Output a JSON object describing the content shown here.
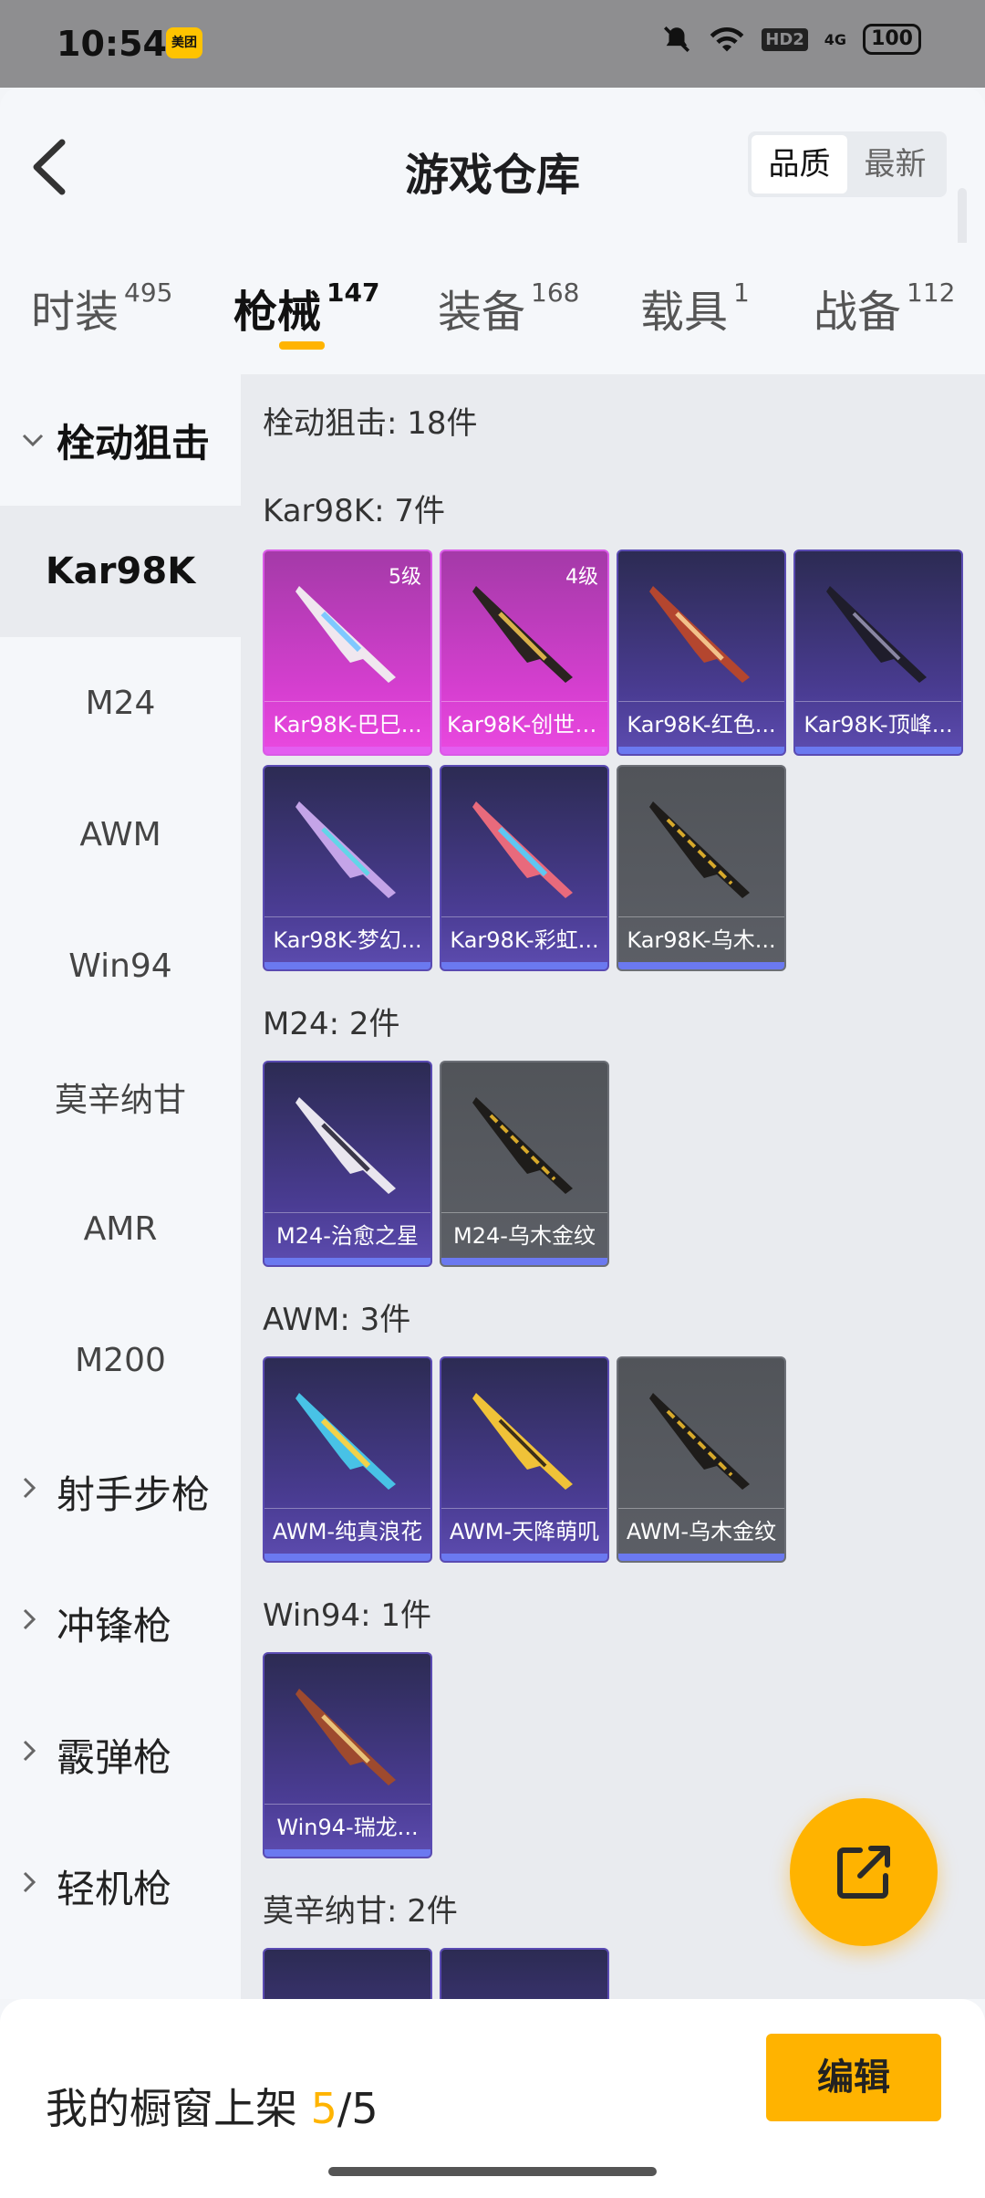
{
  "status_bar": {
    "time": "10:54",
    "app_badge": "美团",
    "hd_label": "HD2",
    "net_label": "4G",
    "battery": "100"
  },
  "header": {
    "title": "游戏仓库",
    "sort_options": [
      "品质",
      "最新"
    ]
  },
  "tabs": [
    {
      "label": "时装",
      "count": "495"
    },
    {
      "label": "枪械",
      "count": "147"
    },
    {
      "label": "装备",
      "count": "168"
    },
    {
      "label": "载具",
      "count": "1"
    },
    {
      "label": "战备",
      "count": "112"
    }
  ],
  "sidebar": {
    "group_open": "栓动狙击",
    "items": [
      "Kar98K",
      "M24",
      "AWM",
      "Win94",
      "莫辛纳甘",
      "AMR",
      "M200"
    ],
    "groups_closed": [
      "射手步枪",
      "冲锋枪",
      "霰弹枪",
      "轻机枪"
    ]
  },
  "content": {
    "category_total": "栓动狙击: 18件",
    "sections": [
      {
        "header": "Kar98K: 7件",
        "items": [
          {
            "name": "Kar98K-巴巳...",
            "level": "5级",
            "rarity": "pink"
          },
          {
            "name": "Kar98K-创世·...",
            "level": "4级",
            "rarity": "pink"
          },
          {
            "name": "Kar98K-红色...",
            "rarity": "purple"
          },
          {
            "name": "Kar98K-顶峰...",
            "rarity": "purple"
          },
          {
            "name": "Kar98K-梦幻...",
            "rarity": "purple"
          },
          {
            "name": "Kar98K-彩虹...",
            "rarity": "purple"
          },
          {
            "name": "Kar98K-乌木...",
            "rarity": "grey"
          }
        ]
      },
      {
        "header": "M24: 2件",
        "items": [
          {
            "name": "M24-治愈之星",
            "rarity": "purple"
          },
          {
            "name": "M24-乌木金纹",
            "rarity": "grey"
          }
        ]
      },
      {
        "header": "AWM: 3件",
        "items": [
          {
            "name": "AWM-纯真浪花",
            "rarity": "purple"
          },
          {
            "name": "AWM-天降萌叽",
            "rarity": "purple"
          },
          {
            "name": "AWM-乌木金纹",
            "rarity": "grey"
          }
        ]
      },
      {
        "header": "Win94: 1件",
        "items": [
          {
            "name": "Win94-瑞龙...",
            "rarity": "purple"
          }
        ]
      },
      {
        "header": "莫辛纳甘: 2件",
        "items": []
      }
    ]
  },
  "bottom": {
    "prefix": "我的橱窗上架 ",
    "current": "5",
    "sep_total": "/5",
    "edit_label": "编辑"
  },
  "colors": {
    "accent": "#ffb300",
    "pink_card": "#d73fd1",
    "purple_card": "#4a3c93",
    "grey_card": "#5c5f66"
  }
}
